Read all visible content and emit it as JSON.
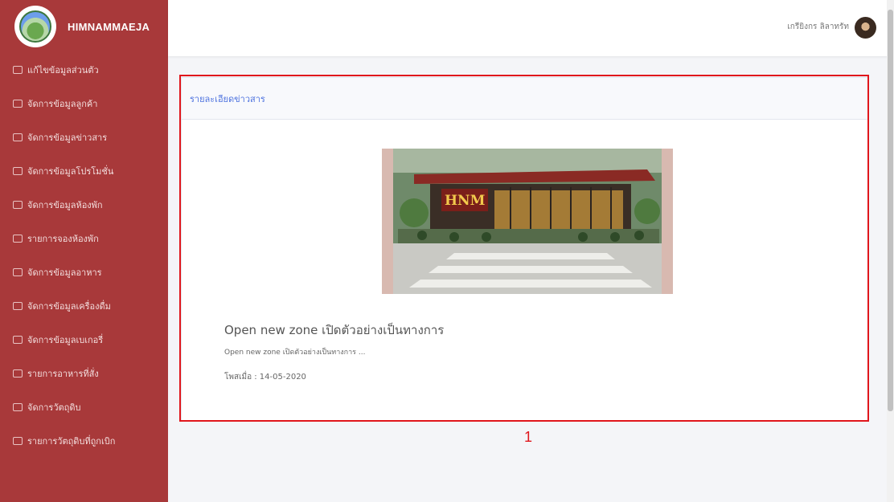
{
  "brand": {
    "name": "HIMNAMMAEJA"
  },
  "sidebar": {
    "items": [
      {
        "label": "แก้ไขข้อมูลส่วนตัว",
        "icon": "user-card-icon"
      },
      {
        "label": "จัดการข้อมูลลูกค้า",
        "icon": "users-icon"
      },
      {
        "label": "จัดการข้อมูลข่าวสาร",
        "icon": "news-icon"
      },
      {
        "label": "จัดการข้อมูลโปรโมชั่น",
        "icon": "tag-icon"
      },
      {
        "label": "จัดการข้อมูลห้องพัก",
        "icon": "bed-icon"
      },
      {
        "label": "รายการจองห้องพัก",
        "icon": "calendar-icon"
      },
      {
        "label": "จัดการข้อมูลอาหาร",
        "icon": "food-icon"
      },
      {
        "label": "จัดการข้อมูลเครื่องดื่ม",
        "icon": "drink-icon"
      },
      {
        "label": "จัดการข้อมูลเบเกอรี่",
        "icon": "bakery-icon"
      },
      {
        "label": "รายการอาหารที่สั่ง",
        "icon": "order-icon"
      },
      {
        "label": "จัดการวัตถุดิบ",
        "icon": "ingredient-icon"
      },
      {
        "label": "รายการวัตถุดิบที่ถูกเบิก",
        "icon": "list-icon"
      }
    ]
  },
  "topbar": {
    "user_name": "เกรียิงกร ลิลาทรัท"
  },
  "card": {
    "title": "รายละเอียดข่าวสาร",
    "news": {
      "title": "Open new zone เปิดตัวอย่างเป็นทางการ",
      "snippet": "Open new zone เปิดตัวอย่างเป็นทางการ ...",
      "date": "โพสเมื่อ : 14-05-2020",
      "image_sign_text": "HNM"
    }
  },
  "annotation": {
    "number": "1"
  },
  "colors": {
    "sidebar": "#a8393a",
    "accent": "#4e73df",
    "highlight": "#e0161c"
  }
}
